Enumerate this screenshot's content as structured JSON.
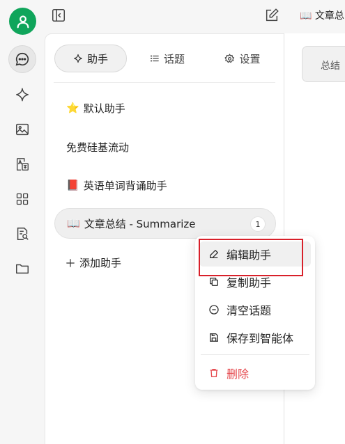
{
  "top": {
    "title": "📖 文章总"
  },
  "tabs": [
    {
      "label": "助手",
      "icon": "sparkle-icon"
    },
    {
      "label": "话题",
      "icon": "list-icon"
    },
    {
      "label": "设置",
      "icon": "gear-icon"
    }
  ],
  "assistants": [
    {
      "emoji": "⭐",
      "name": "默认助手"
    },
    {
      "emoji": "",
      "name": "免费硅基流动"
    },
    {
      "emoji": "📕",
      "name": "英语单词背诵助手"
    },
    {
      "emoji": "📖",
      "name": "文章总结 - Summarize",
      "count": "1"
    }
  ],
  "add_assistant": "添加助手",
  "right": {
    "summary_chip": "总结"
  },
  "context_menu": {
    "items": [
      {
        "label": "编辑助手",
        "icon": "edit-icon"
      },
      {
        "label": "复制助手",
        "icon": "copy-icon"
      },
      {
        "label": "清空话题",
        "icon": "minus-circle-icon"
      },
      {
        "label": "保存到智能体",
        "icon": "save-icon"
      }
    ],
    "delete_label": "删除",
    "danger_color": "#e5484d"
  },
  "colors": {
    "avatar": "#10a55b",
    "highlight_box": "#d8202a"
  }
}
